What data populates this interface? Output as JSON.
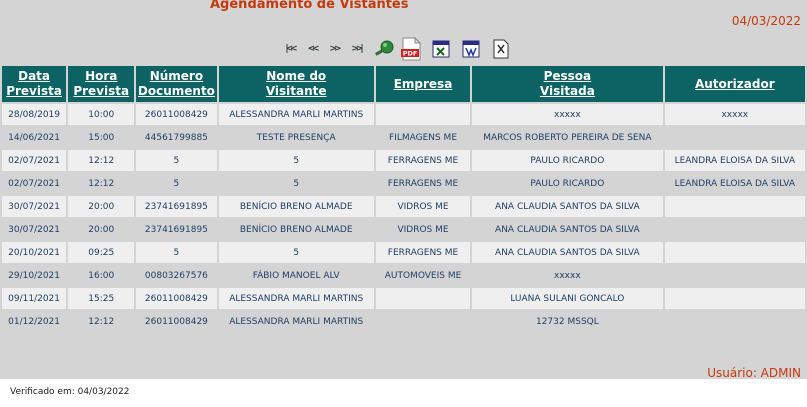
{
  "page": {
    "title": "Agendamento de Vistantes",
    "date": "04/03/2022",
    "user_label": "Usuário: ADMIN",
    "verified_label": "Verificado em: 04/03/2022"
  },
  "toolbar": {
    "first": "|<<",
    "prev": "<<",
    "next": ">>",
    "last": ">>|",
    "pdf_label": "PDF"
  },
  "table": {
    "headers": [
      [
        "Data",
        "Prevista"
      ],
      [
        "Hora",
        "Prevista"
      ],
      [
        "Número",
        "Documento"
      ],
      [
        "Nome do",
        "Visitante"
      ],
      [
        "Empresa",
        ""
      ],
      [
        "Pessoa",
        "Visitada"
      ],
      [
        "Autorizador",
        ""
      ]
    ],
    "rows": [
      [
        "28/08/2019",
        "10:00",
        "26011008429",
        "ALESSANDRA MARLI MARTINS",
        "",
        "xxxxx",
        "xxxxx"
      ],
      [
        "14/06/2021",
        "15:00",
        "44561799885",
        "TESTE PRESENÇA",
        "FILMAGENS ME",
        "MARCOS ROBERTO PEREIRA DE SENA",
        ""
      ],
      [
        "02/07/2021",
        "12:12",
        "5",
        "5",
        "FERRAGENS ME",
        "PAULO RICARDO",
        "LEANDRA ELOISA DA SILVA"
      ],
      [
        "02/07/2021",
        "12:12",
        "5",
        "5",
        "FERRAGENS ME",
        "PAULO RICARDO",
        "LEANDRA ELOISA DA SILVA"
      ],
      [
        "30/07/2021",
        "20:00",
        "23741691895",
        "BENÍCIO BRENO ALMADE",
        "VIDROS ME",
        "ANA CLAUDIA SANTOS DA SILVA",
        ""
      ],
      [
        "30/07/2021",
        "20:00",
        "23741691895",
        "BENÍCIO BRENO ALMADE",
        "VIDROS ME",
        "ANA CLAUDIA SANTOS DA SILVA",
        ""
      ],
      [
        "20/10/2021",
        "09:25",
        "5",
        "5",
        "FERRAGENS ME",
        "ANA CLAUDIA SANTOS DA SILVA",
        ""
      ],
      [
        "29/10/2021",
        "16:00",
        "00803267576",
        "FÁBIO MANOEL ALV",
        "AUTOMOVEIS ME",
        "xxxxx",
        ""
      ],
      [
        "09/11/2021",
        "15:25",
        "26011008429",
        "ALESSANDRA MARLI MARTINS",
        "",
        "LUANA SULANI GONCALO",
        ""
      ],
      [
        "01/12/2021",
        "12:12",
        "26011008429",
        "ALESSANDRA MARLI MARTINS",
        "",
        "12732 MSSQL",
        ""
      ]
    ]
  },
  "colors": {
    "header_bg": "#0d6363",
    "accent_text": "#c43a0c",
    "cell_text": "#1e3f66",
    "row_light": "#efefef",
    "row_dark": "#d4d4d4"
  },
  "icons": [
    "first-page-icon",
    "previous-page-icon",
    "next-page-icon",
    "last-page-icon",
    "search-icon",
    "pdf-icon",
    "excel-icon",
    "word-icon",
    "xml-icon"
  ]
}
